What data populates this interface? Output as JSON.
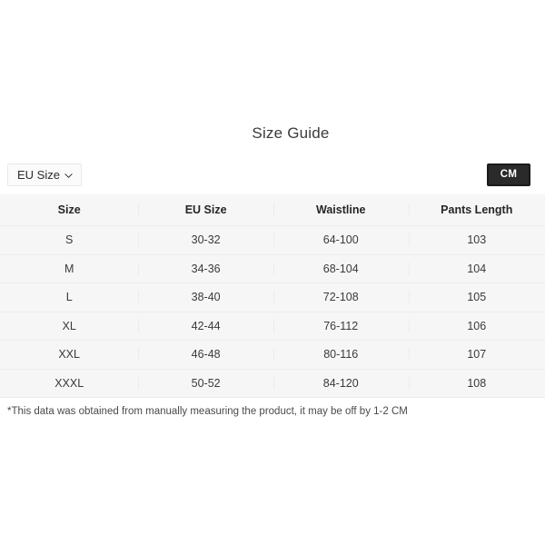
{
  "title": "Size Guide",
  "controls": {
    "unit_select": {
      "label": "EU Size",
      "icon": "chevron-down-icon"
    },
    "measure_toggle": {
      "label": "CM",
      "active_color": "#2a2a2a",
      "text_color": "#ffffff"
    }
  },
  "table": {
    "headers": [
      "Size",
      "EU Size",
      "Waistline",
      "Pants Length"
    ],
    "rows": [
      {
        "size": "S",
        "eu_size": "30-32",
        "waistline": "64-100",
        "pants_length": "103"
      },
      {
        "size": "M",
        "eu_size": "34-36",
        "waistline": "68-104",
        "pants_length": "104"
      },
      {
        "size": "L",
        "eu_size": "38-40",
        "waistline": "72-108",
        "pants_length": "105"
      },
      {
        "size": "XL",
        "eu_size": "42-44",
        "waistline": "76-112",
        "pants_length": "106"
      },
      {
        "size": "XXL",
        "eu_size": "46-48",
        "waistline": "80-116",
        "pants_length": "107"
      },
      {
        "size": "XXXL",
        "eu_size": "50-52",
        "waistline": "84-120",
        "pants_length": "108"
      }
    ]
  },
  "footnote": "*This data was obtained from manually measuring the product, it may be off by 1-2 CM",
  "colors": {
    "page_background": "#ffffff",
    "table_background": "#f6f6f6",
    "grid_line": "#ececec",
    "text": "#3a3a3a",
    "heading_text": "#262626"
  }
}
